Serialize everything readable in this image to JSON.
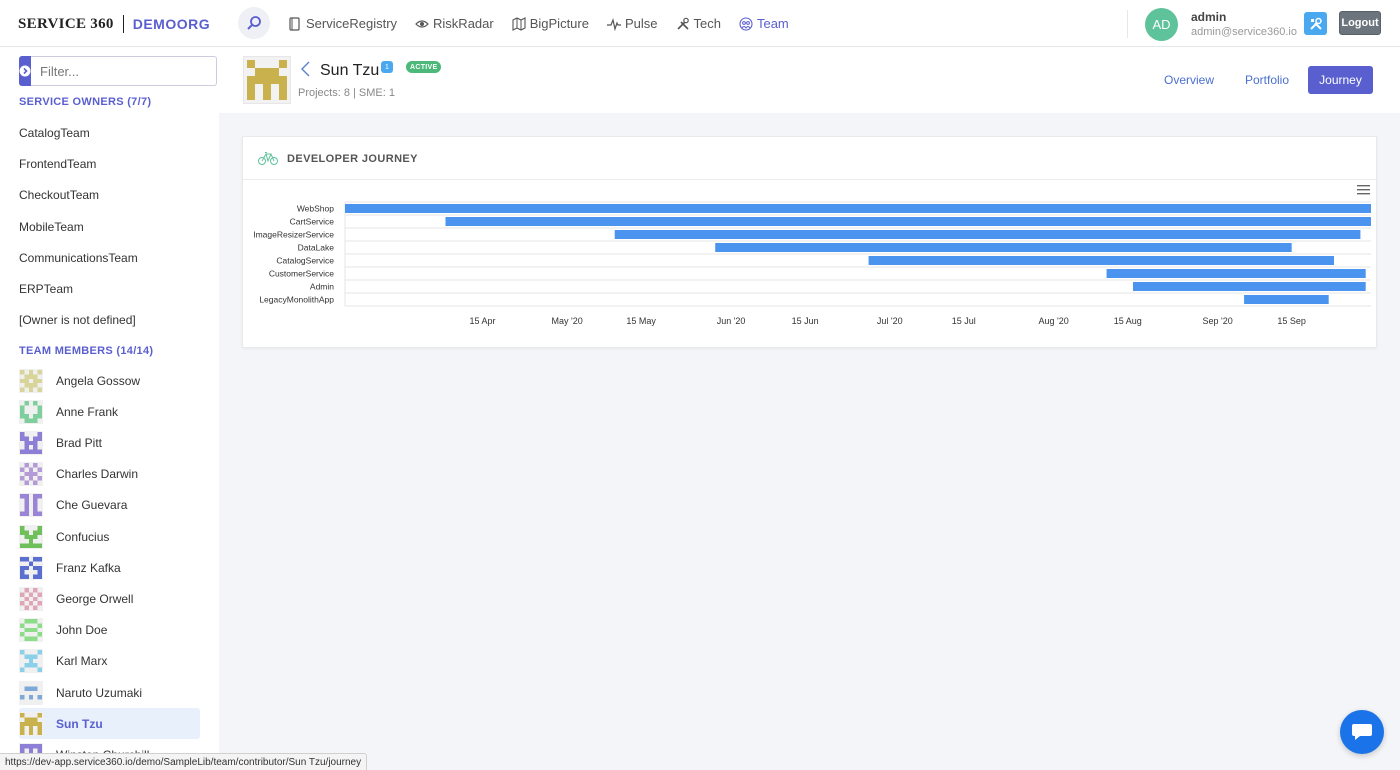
{
  "header": {
    "logo_brand": "SERVICE 360",
    "logo_org": "DEMOORG",
    "nav": [
      {
        "label": "ServiceRegistry",
        "icon": "service-registry-icon"
      },
      {
        "label": "RiskRadar",
        "icon": "eye-icon"
      },
      {
        "label": "BigPicture",
        "icon": "map-icon"
      },
      {
        "label": "Pulse",
        "icon": "pulse-icon"
      },
      {
        "label": "Tech",
        "icon": "tools-icon"
      },
      {
        "label": "Team",
        "icon": "team-icon",
        "active": true
      }
    ],
    "user_initials": "AD",
    "user_name": "admin",
    "user_email": "admin@service360.io",
    "logout_label": "Logout"
  },
  "sidebar": {
    "filter_placeholder": "Filter...",
    "owners_heading": "SERVICE OWNERS (7/7)",
    "owners": [
      "CatalogTeam",
      "FrontendTeam",
      "CheckoutTeam",
      "MobileTeam",
      "CommunicationsTeam",
      "ERPTeam",
      "[Owner is not defined]"
    ],
    "members_heading": "TEAM MEMBERS (14/14)",
    "members": [
      {
        "name": "Angela Gossow",
        "color": "#d8d49a"
      },
      {
        "name": "Anne Frank",
        "color": "#7fcf9e"
      },
      {
        "name": "Brad Pitt",
        "color": "#8d7ed6"
      },
      {
        "name": "Charles Darwin",
        "color": "#b59ad8"
      },
      {
        "name": "Che Guevara",
        "color": "#9a84d6"
      },
      {
        "name": "Confucius",
        "color": "#6fbf5a"
      },
      {
        "name": "Franz Kafka",
        "color": "#5a6fd0"
      },
      {
        "name": "George Orwell",
        "color": "#e0a6b8"
      },
      {
        "name": "John Doe",
        "color": "#8ddc8a"
      },
      {
        "name": "Karl Marx",
        "color": "#8ad0e8"
      },
      {
        "name": "Naruto Uzumaki",
        "color": "#7fa8d8"
      },
      {
        "name": "Sun Tzu",
        "color": "#c9b24e",
        "selected": true
      },
      {
        "name": "Winston Churchill",
        "color": "#8d7ed6"
      }
    ]
  },
  "status_url": "https://dev-app.service360.io/demo/SampleLib/team/contributor/Sun Tzu/journey",
  "profile": {
    "name": "Sun Tzu",
    "badge_count": "1",
    "badge_status": "ACTIVE",
    "meta": "Projects: 8 | SME: 1",
    "tabs": [
      {
        "label": "Overview",
        "active": false
      },
      {
        "label": "Portfolio",
        "active": false
      },
      {
        "label": "Journey",
        "active": true
      }
    ]
  },
  "card": {
    "title": "DEVELOPER JOURNEY"
  },
  "colors": {
    "accent": "#5a5fd0",
    "bar": "#4a94ef"
  },
  "chart_data": {
    "type": "bar",
    "orientation": "horizontal-timeline",
    "categories": [
      "WebShop",
      "CartService",
      "ImageResizerService",
      "DataLake",
      "CatalogService",
      "CustomerService",
      "Admin",
      "LegacyMonolithApp"
    ],
    "series": [
      {
        "ranges": [
          [
            "2020-03-20",
            "2020-09-30"
          ],
          [
            "2020-04-08",
            "2020-09-30"
          ],
          [
            "2020-05-10",
            "2020-09-28"
          ],
          [
            "2020-05-29",
            "2020-09-15"
          ],
          [
            "2020-06-27",
            "2020-09-23"
          ],
          [
            "2020-08-11",
            "2020-09-29"
          ],
          [
            "2020-08-16",
            "2020-09-29"
          ],
          [
            "2020-09-06",
            "2020-09-22"
          ]
        ]
      }
    ],
    "x_ticks": [
      "15 Apr",
      "May '20",
      "15 May",
      "Jun '20",
      "15 Jun",
      "Jul '20",
      "15 Jul",
      "Aug '20",
      "15 Aug",
      "Sep '20",
      "15 Sep"
    ],
    "x_tick_dates": [
      "2020-04-15",
      "2020-05-01",
      "2020-05-15",
      "2020-06-01",
      "2020-06-15",
      "2020-07-01",
      "2020-07-15",
      "2020-08-01",
      "2020-08-15",
      "2020-09-01",
      "2020-09-15"
    ],
    "xlim": [
      "2020-03-20",
      "2020-09-30"
    ],
    "grid": true,
    "legend": "none"
  }
}
